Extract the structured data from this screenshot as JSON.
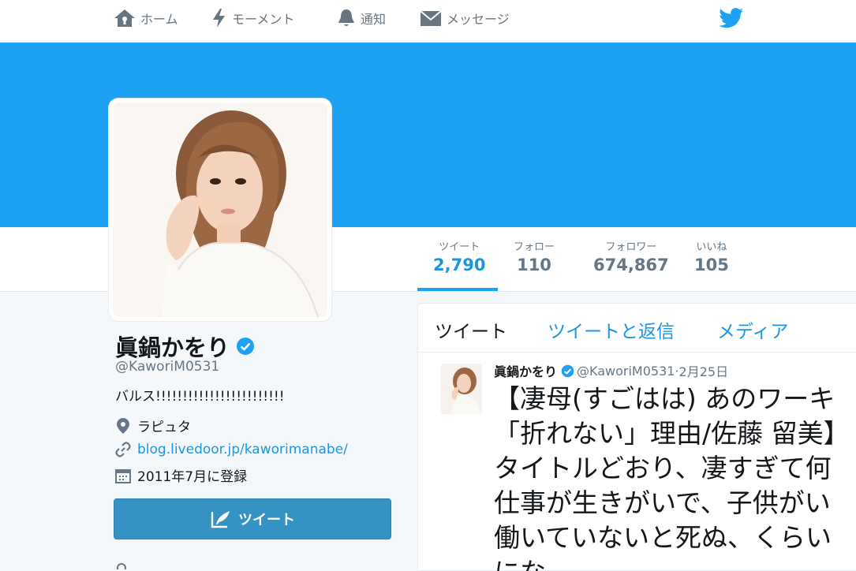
{
  "nav": {
    "home": "ホーム",
    "moments": "モーメント",
    "notifications": "通知",
    "messages": "メッセージ"
  },
  "colors": {
    "banner": "#1da1f2",
    "accent": "#1b95e0",
    "tweet_button": "#3493c2",
    "verified": "#1da1f2"
  },
  "stats": [
    {
      "label": "ツイート",
      "value": "2,790",
      "active": true
    },
    {
      "label": "フォロー",
      "value": "110",
      "active": false
    },
    {
      "label": "フォロワー",
      "value": "674,867",
      "active": false
    },
    {
      "label": "いいね",
      "value": "105",
      "active": false
    }
  ],
  "profile": {
    "name": "眞鍋かをり",
    "handle": "@KaworiM0531",
    "bio": "バルス!!!!!!!!!!!!!!!!!!!!!!!!",
    "location": "ラピュタ",
    "website": "blog.livedoor.jp/kaworimanabe/",
    "joined": "2011年7月に登録",
    "tweet_button": "ツイート"
  },
  "timeline": {
    "tabs": [
      "ツイート",
      "ツイートと返信",
      "メディア"
    ],
    "tweet": {
      "name": "眞鍋かをり",
      "handle": "@KaworiM0531",
      "separator": " · ",
      "date": "2月25日",
      "lines": [
        "【凄母(すごはは) あのワーキ",
        "「折れない」理由/佐藤 留美】",
        "タイトルどおり、凄すぎて何",
        "仕事が生きがいで、子供がい",
        "働いていないと死ぬ、くらい",
        "にな"
      ]
    }
  },
  "icons": [
    "home-icon",
    "lightning-icon",
    "bell-icon",
    "envelope-icon",
    "twitter-bird-icon",
    "verified-badge-icon",
    "location-pin-icon",
    "link-icon",
    "calendar-icon",
    "quill-icon"
  ]
}
